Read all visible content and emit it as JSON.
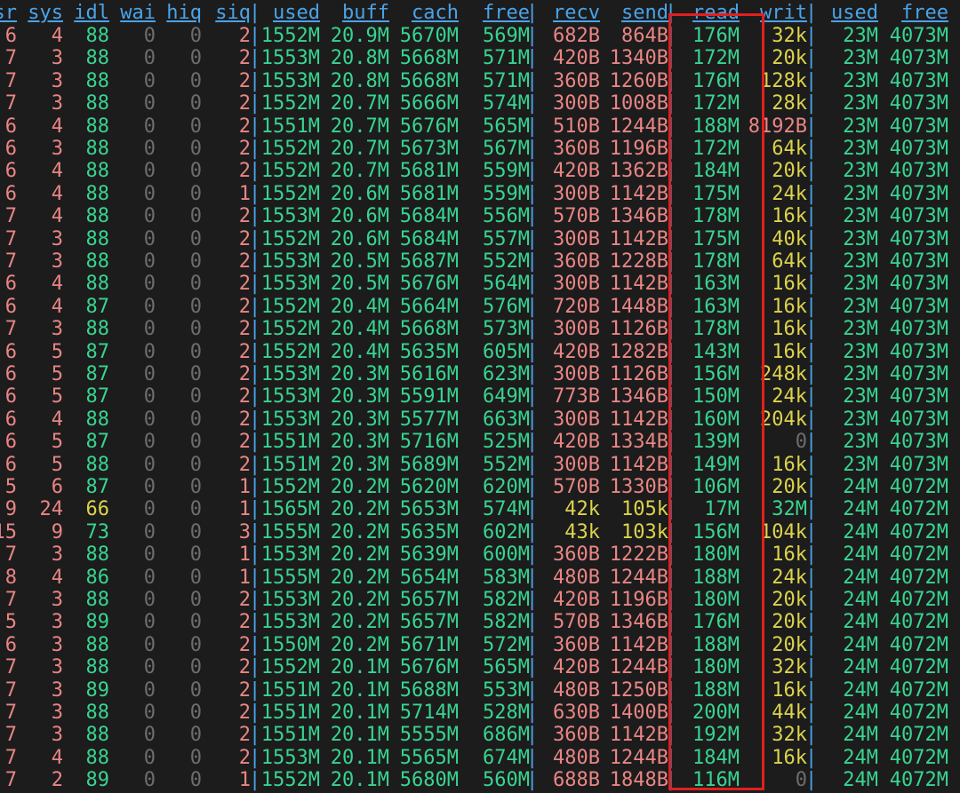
{
  "colors": {
    "background": "#1c1c1c",
    "header": "#4aa3e8",
    "green": "#38d490",
    "red": "#ea8585",
    "gray": "#6d6d6d",
    "yellow": "#dcd34c",
    "highlight": "#e21f1f"
  },
  "header": [
    "sr",
    "sys",
    "idl",
    "wai",
    "hiq",
    "siq",
    "used",
    "buff",
    "cach",
    "free",
    "recv",
    "send",
    "read",
    "writ",
    "used",
    "free"
  ],
  "rows": [
    [
      "6",
      "4",
      "88",
      "0",
      "0",
      "2",
      "1552M",
      "20.9M",
      "5670M",
      "569M",
      "682B",
      "864B",
      "176M",
      "32k",
      "23M",
      "4073M"
    ],
    [
      "7",
      "3",
      "88",
      "0",
      "0",
      "2",
      "1553M",
      "20.8M",
      "5668M",
      "571M",
      "420B",
      "1340B",
      "172M",
      "20k",
      "23M",
      "4073M"
    ],
    [
      "7",
      "3",
      "88",
      "0",
      "0",
      "2",
      "1553M",
      "20.8M",
      "5668M",
      "571M",
      "360B",
      "1260B",
      "176M",
      "128k",
      "23M",
      "4073M"
    ],
    [
      "7",
      "3",
      "88",
      "0",
      "0",
      "2",
      "1552M",
      "20.7M",
      "5666M",
      "574M",
      "300B",
      "1008B",
      "172M",
      "28k",
      "23M",
      "4073M"
    ],
    [
      "6",
      "4",
      "88",
      "0",
      "0",
      "2",
      "1551M",
      "20.7M",
      "5676M",
      "565M",
      "510B",
      "1244B",
      "188M",
      "8192B",
      "23M",
      "4073M"
    ],
    [
      "6",
      "3",
      "88",
      "0",
      "0",
      "2",
      "1552M",
      "20.7M",
      "5673M",
      "567M",
      "360B",
      "1196B",
      "172M",
      "64k",
      "23M",
      "4073M"
    ],
    [
      "6",
      "4",
      "88",
      "0",
      "0",
      "2",
      "1552M",
      "20.7M",
      "5681M",
      "559M",
      "420B",
      "1362B",
      "184M",
      "20k",
      "23M",
      "4073M"
    ],
    [
      "6",
      "4",
      "88",
      "0",
      "0",
      "1",
      "1552M",
      "20.6M",
      "5681M",
      "559M",
      "300B",
      "1142B",
      "175M",
      "24k",
      "23M",
      "4073M"
    ],
    [
      "7",
      "4",
      "88",
      "0",
      "0",
      "2",
      "1553M",
      "20.6M",
      "5684M",
      "556M",
      "570B",
      "1346B",
      "178M",
      "16k",
      "23M",
      "4073M"
    ],
    [
      "7",
      "3",
      "88",
      "0",
      "0",
      "2",
      "1552M",
      "20.6M",
      "5684M",
      "557M",
      "300B",
      "1142B",
      "175M",
      "40k",
      "23M",
      "4073M"
    ],
    [
      "7",
      "3",
      "88",
      "0",
      "0",
      "2",
      "1553M",
      "20.5M",
      "5687M",
      "552M",
      "360B",
      "1228B",
      "178M",
      "64k",
      "23M",
      "4073M"
    ],
    [
      "6",
      "4",
      "88",
      "0",
      "0",
      "2",
      "1553M",
      "20.5M",
      "5676M",
      "564M",
      "300B",
      "1142B",
      "163M",
      "16k",
      "23M",
      "4073M"
    ],
    [
      "6",
      "4",
      "87",
      "0",
      "0",
      "2",
      "1552M",
      "20.4M",
      "5664M",
      "576M",
      "720B",
      "1448B",
      "163M",
      "16k",
      "23M",
      "4073M"
    ],
    [
      "7",
      "3",
      "88",
      "0",
      "0",
      "2",
      "1552M",
      "20.4M",
      "5668M",
      "573M",
      "300B",
      "1126B",
      "178M",
      "16k",
      "23M",
      "4073M"
    ],
    [
      "6",
      "5",
      "87",
      "0",
      "0",
      "2",
      "1552M",
      "20.4M",
      "5635M",
      "605M",
      "420B",
      "1282B",
      "143M",
      "16k",
      "23M",
      "4073M"
    ],
    [
      "6",
      "5",
      "87",
      "0",
      "0",
      "2",
      "1553M",
      "20.3M",
      "5616M",
      "623M",
      "300B",
      "1126B",
      "156M",
      "248k",
      "23M",
      "4073M"
    ],
    [
      "6",
      "5",
      "87",
      "0",
      "0",
      "2",
      "1553M",
      "20.3M",
      "5591M",
      "649M",
      "773B",
      "1346B",
      "150M",
      "24k",
      "23M",
      "4073M"
    ],
    [
      "6",
      "4",
      "88",
      "0",
      "0",
      "2",
      "1553M",
      "20.3M",
      "5577M",
      "663M",
      "300B",
      "1142B",
      "160M",
      "204k",
      "23M",
      "4073M"
    ],
    [
      "6",
      "5",
      "87",
      "0",
      "0",
      "2",
      "1551M",
      "20.3M",
      "5716M",
      "525M",
      "420B",
      "1334B",
      "139M",
      "0",
      "23M",
      "4073M"
    ],
    [
      "6",
      "5",
      "88",
      "0",
      "0",
      "2",
      "1551M",
      "20.3M",
      "5689M",
      "552M",
      "300B",
      "1142B",
      "149M",
      "16k",
      "23M",
      "4073M"
    ],
    [
      "5",
      "6",
      "87",
      "0",
      "0",
      "1",
      "1552M",
      "20.2M",
      "5620M",
      "620M",
      "570B",
      "1330B",
      "106M",
      "20k",
      "24M",
      "4072M"
    ],
    [
      "9",
      "24",
      "66",
      "0",
      "0",
      "1",
      "1565M",
      "20.2M",
      "5653M",
      "574M",
      "42k",
      "105k",
      "17M",
      "32M",
      "24M",
      "4072M"
    ],
    [
      "15",
      "9",
      "73",
      "0",
      "0",
      "3",
      "1555M",
      "20.2M",
      "5635M",
      "602M",
      "43k",
      "103k",
      "156M",
      "104k",
      "24M",
      "4072M"
    ],
    [
      "7",
      "3",
      "88",
      "0",
      "0",
      "1",
      "1553M",
      "20.2M",
      "5639M",
      "600M",
      "360B",
      "1222B",
      "180M",
      "16k",
      "24M",
      "4072M"
    ],
    [
      "8",
      "4",
      "86",
      "0",
      "0",
      "1",
      "1555M",
      "20.2M",
      "5654M",
      "583M",
      "480B",
      "1244B",
      "188M",
      "24k",
      "24M",
      "4072M"
    ],
    [
      "7",
      "3",
      "88",
      "0",
      "0",
      "2",
      "1553M",
      "20.2M",
      "5657M",
      "582M",
      "420B",
      "1196B",
      "180M",
      "20k",
      "24M",
      "4072M"
    ],
    [
      "5",
      "3",
      "89",
      "0",
      "0",
      "2",
      "1553M",
      "20.2M",
      "5657M",
      "582M",
      "570B",
      "1346B",
      "176M",
      "20k",
      "24M",
      "4072M"
    ],
    [
      "6",
      "3",
      "88",
      "0",
      "0",
      "2",
      "1550M",
      "20.2M",
      "5671M",
      "572M",
      "360B",
      "1142B",
      "188M",
      "20k",
      "24M",
      "4072M"
    ],
    [
      "7",
      "3",
      "88",
      "0",
      "0",
      "2",
      "1552M",
      "20.1M",
      "5676M",
      "565M",
      "420B",
      "1244B",
      "180M",
      "32k",
      "24M",
      "4072M"
    ],
    [
      "7",
      "3",
      "89",
      "0",
      "0",
      "2",
      "1551M",
      "20.1M",
      "5688M",
      "553M",
      "480B",
      "1250B",
      "188M",
      "16k",
      "24M",
      "4072M"
    ],
    [
      "7",
      "3",
      "88",
      "0",
      "0",
      "2",
      "1551M",
      "20.1M",
      "5714M",
      "528M",
      "630B",
      "1400B",
      "200M",
      "44k",
      "24M",
      "4072M"
    ],
    [
      "7",
      "3",
      "88",
      "0",
      "0",
      "2",
      "1551M",
      "20.1M",
      "5555M",
      "686M",
      "360B",
      "1142B",
      "192M",
      "32k",
      "24M",
      "4072M"
    ],
    [
      "7",
      "4",
      "88",
      "0",
      "0",
      "2",
      "1553M",
      "20.1M",
      "5565M",
      "674M",
      "480B",
      "1244B",
      "184M",
      "16k",
      "24M",
      "4072M"
    ],
    [
      "7",
      "2",
      "89",
      "0",
      "0",
      "1",
      "1552M",
      "20.1M",
      "5680M",
      "560M",
      "688B",
      "1848B",
      "116M",
      "0",
      "24M",
      "4072M"
    ]
  ]
}
